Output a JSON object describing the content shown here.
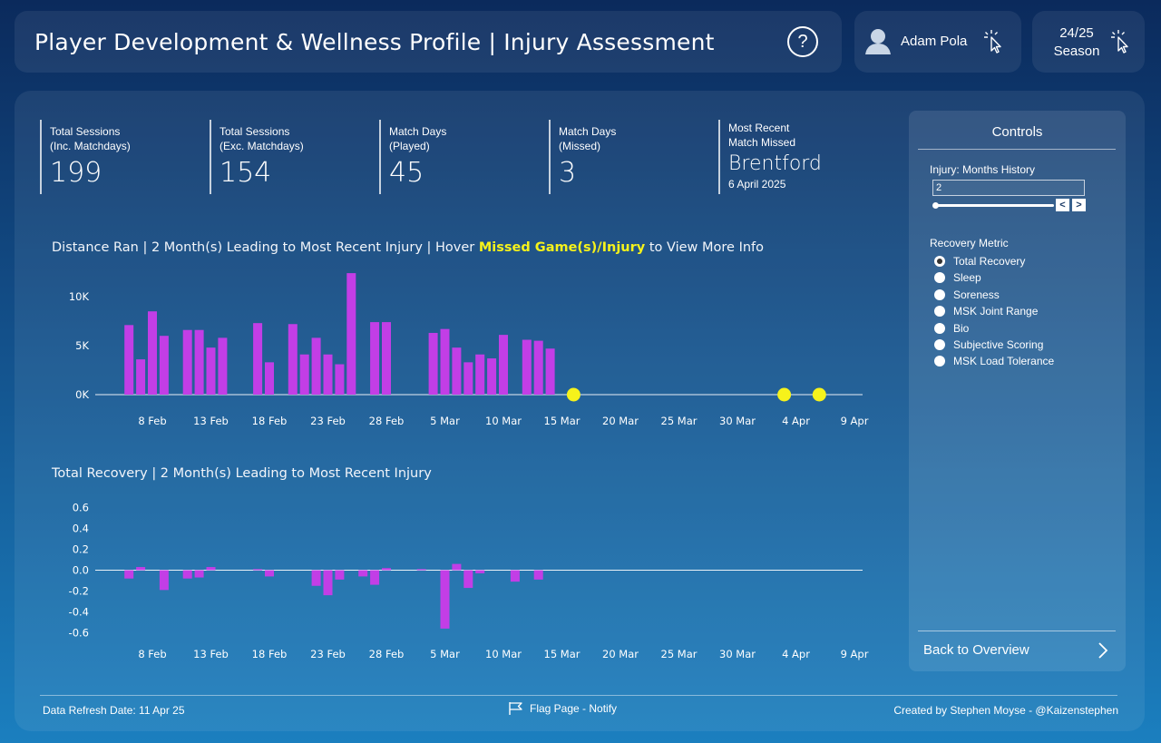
{
  "header": {
    "title": "Player Development & Wellness Profile | Injury Assessment",
    "help_label": "?",
    "user_name": "Adam Pola",
    "season_year": "24/25",
    "season_label": "Season"
  },
  "kpis": [
    {
      "line1": "Total Sessions",
      "line2": "(Inc. Matchdays)",
      "value": "199"
    },
    {
      "line1": "Total Sessions",
      "line2": "(Exc. Matchdays)",
      "value": "154"
    },
    {
      "line1": "Match Days",
      "line2": "(Played)",
      "value": "45"
    },
    {
      "line1": "Match Days",
      "line2": "(Missed)",
      "value": "3"
    }
  ],
  "recent": {
    "line1": "Most Recent",
    "line2": "Match Missed",
    "value": "Brentford",
    "date": "6 April 2025"
  },
  "distance_chart": {
    "title_prefix": "Distance Ran | 2 Month(s) Leading to Most Recent Injury | Hover ",
    "title_highlight": "Missed Game(s)/Injury",
    "title_suffix": " to View More Info"
  },
  "recovery_chart": {
    "title": "Total Recovery | 2 Month(s) Leading to Most Recent Injury"
  },
  "chart_data": [
    {
      "type": "bar",
      "x_ticks": [
        "8 Feb",
        "13 Feb",
        "18 Feb",
        "23 Feb",
        "28 Feb",
        "5 Mar",
        "10 Mar",
        "15 Mar",
        "20 Mar",
        "25 Mar",
        "30 Mar",
        "4 Apr",
        "9 Apr"
      ],
      "x_range": [
        "2025-02-03",
        "2025-04-09"
      ],
      "y_ticks": [
        "0K",
        "5K",
        "10K"
      ],
      "ylim": [
        0,
        12500
      ],
      "bar_color": "#c23ee6",
      "points": [
        {
          "date": "2025-02-06",
          "value": 7100
        },
        {
          "date": "2025-02-07",
          "value": 3600
        },
        {
          "date": "2025-02-08",
          "value": 8500
        },
        {
          "date": "2025-02-09",
          "value": 6000
        },
        {
          "date": "2025-02-11",
          "value": 6600
        },
        {
          "date": "2025-02-12",
          "value": 6600
        },
        {
          "date": "2025-02-13",
          "value": 4800
        },
        {
          "date": "2025-02-14",
          "value": 5800
        },
        {
          "date": "2025-02-17",
          "value": 7300
        },
        {
          "date": "2025-02-18",
          "value": 3300
        },
        {
          "date": "2025-02-20",
          "value": 7200
        },
        {
          "date": "2025-02-21",
          "value": 4100
        },
        {
          "date": "2025-02-22",
          "value": 5800
        },
        {
          "date": "2025-02-23",
          "value": 4100
        },
        {
          "date": "2025-02-24",
          "value": 3100
        },
        {
          "date": "2025-02-25",
          "value": 12400
        },
        {
          "date": "2025-02-27",
          "value": 7400
        },
        {
          "date": "2025-02-28",
          "value": 7400
        },
        {
          "date": "2025-03-04",
          "value": 6300
        },
        {
          "date": "2025-03-05",
          "value": 6700
        },
        {
          "date": "2025-03-06",
          "value": 4800
        },
        {
          "date": "2025-03-07",
          "value": 3300
        },
        {
          "date": "2025-03-08",
          "value": 4100
        },
        {
          "date": "2025-03-09",
          "value": 3700
        },
        {
          "date": "2025-03-10",
          "value": 6100
        },
        {
          "date": "2025-03-12",
          "value": 5600
        },
        {
          "date": "2025-03-13",
          "value": 5500
        },
        {
          "date": "2025-03-14",
          "value": 4700
        }
      ],
      "missed_games": [
        "2025-03-16",
        "2025-04-03",
        "2025-04-06"
      ],
      "marker_color": "#f6f21b"
    },
    {
      "type": "bar",
      "x_ticks": [
        "8 Feb",
        "13 Feb",
        "18 Feb",
        "23 Feb",
        "28 Feb",
        "5 Mar",
        "10 Mar",
        "15 Mar",
        "20 Mar",
        "25 Mar",
        "30 Mar",
        "4 Apr",
        "9 Apr"
      ],
      "x_range": [
        "2025-02-03",
        "2025-04-09"
      ],
      "y_ticks": [
        "0.6",
        "0.4",
        "0.2",
        "0.0",
        "-0.2",
        "-0.4",
        "-0.6"
      ],
      "ylim": [
        -0.6,
        0.6
      ],
      "bar_color": "#c23ee6",
      "points": [
        {
          "date": "2025-02-06",
          "value": -0.08
        },
        {
          "date": "2025-02-07",
          "value": 0.03
        },
        {
          "date": "2025-02-09",
          "value": -0.19
        },
        {
          "date": "2025-02-11",
          "value": -0.08
        },
        {
          "date": "2025-02-12",
          "value": -0.07
        },
        {
          "date": "2025-02-13",
          "value": 0.03
        },
        {
          "date": "2025-02-17",
          "value": 0.01
        },
        {
          "date": "2025-02-18",
          "value": -0.06
        },
        {
          "date": "2025-02-22",
          "value": -0.15
        },
        {
          "date": "2025-02-23",
          "value": -0.24
        },
        {
          "date": "2025-02-24",
          "value": -0.09
        },
        {
          "date": "2025-02-26",
          "value": -0.06
        },
        {
          "date": "2025-02-27",
          "value": -0.14
        },
        {
          "date": "2025-02-28",
          "value": 0.02
        },
        {
          "date": "2025-03-03",
          "value": 0.01
        },
        {
          "date": "2025-03-05",
          "value": -0.56
        },
        {
          "date": "2025-03-06",
          "value": 0.06
        },
        {
          "date": "2025-03-07",
          "value": -0.17
        },
        {
          "date": "2025-03-08",
          "value": -0.03
        },
        {
          "date": "2025-03-11",
          "value": -0.11
        },
        {
          "date": "2025-03-13",
          "value": -0.09
        }
      ]
    }
  ],
  "controls": {
    "title": "Controls",
    "months_label": "Injury: Months History",
    "months_value": "2",
    "months_slider_fraction": 0.0,
    "prev_label": "<",
    "next_label": ">",
    "metric_label": "Recovery Metric",
    "metrics": [
      {
        "label": "Total Recovery",
        "selected": true
      },
      {
        "label": "Sleep",
        "selected": false
      },
      {
        "label": "Soreness",
        "selected": false
      },
      {
        "label": "MSK Joint Range",
        "selected": false
      },
      {
        "label": "Bio",
        "selected": false
      },
      {
        "label": "Subjective Scoring",
        "selected": false
      },
      {
        "label": "MSK Load Tolerance",
        "selected": false
      }
    ],
    "back_label": "Back to Overview"
  },
  "footer": {
    "refresh": "Data Refresh Date: 11 Apr 25",
    "flag": "Flag Page - Notify",
    "credit": "Created by Stephen Moyse - @Kaizenstephen"
  }
}
